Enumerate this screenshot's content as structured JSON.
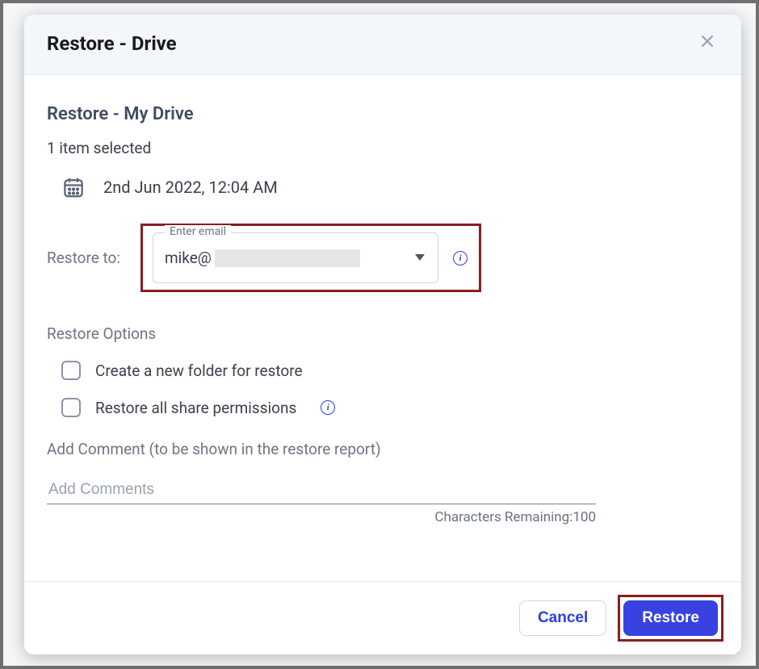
{
  "header": {
    "title": "Restore - Drive"
  },
  "body": {
    "subtitle": "Restore -  My Drive",
    "selected_count": "1 item selected",
    "timestamp": "2nd Jun 2022, 12:04 AM",
    "restore_to_label": "Restore to:",
    "email_field": {
      "float_label": "Enter email",
      "value_prefix": "mike@"
    },
    "options_label": "Restore Options",
    "option_new_folder": "Create a new folder for restore",
    "option_share_perms": "Restore all share permissions",
    "comment_label": "Add Comment (to be shown in the restore report)",
    "comment_placeholder": "Add Comments",
    "chars_remaining": "Characters Remaining:100"
  },
  "footer": {
    "cancel": "Cancel",
    "restore": "Restore"
  }
}
